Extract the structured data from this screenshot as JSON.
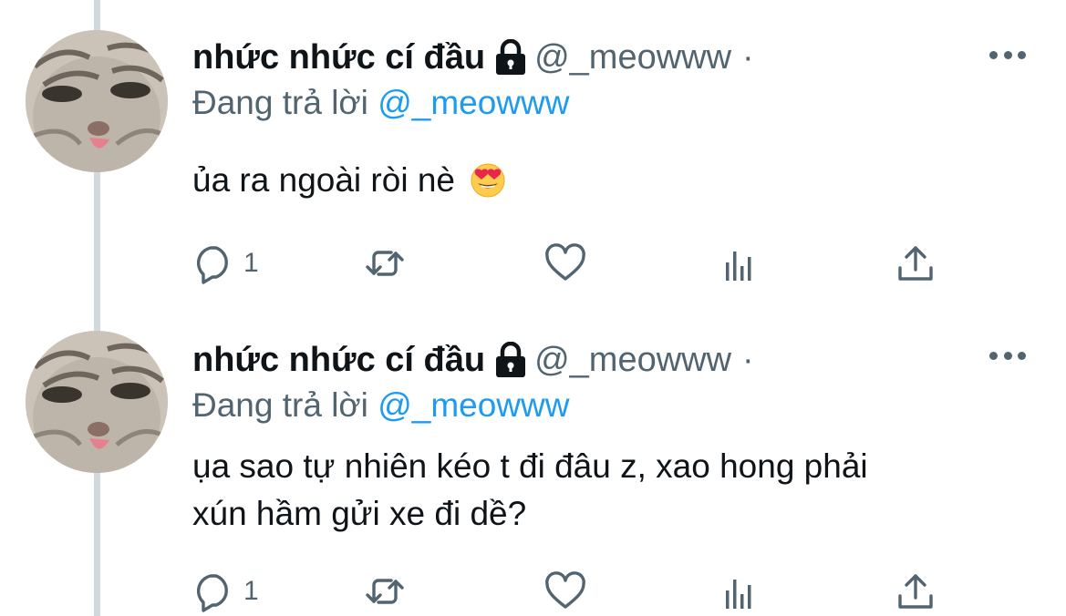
{
  "colors": {
    "accent": "#1d9bf0",
    "text": "#0f1419",
    "secondary": "#536471",
    "thread_line": "#cfd9de"
  },
  "tweets": [
    {
      "display_name": "nhức nhức cí đầu",
      "protected_icon": "lock-icon",
      "handle": "@_meowww",
      "dot": "·",
      "replying_prefix": "Đang trả lời",
      "replying_to": "@_meowww",
      "text_lines": [
        "ủa ra ngoài ròi nè"
      ],
      "emoji": "smiling-face-with-heart-eyes-emoji",
      "reply_count": "1",
      "icons": [
        "reply-icon",
        "retweet-icon",
        "like-icon",
        "views-icon",
        "share-icon"
      ]
    },
    {
      "display_name": "nhức nhức cí đầu",
      "protected_icon": "lock-icon",
      "handle": "@_meowww",
      "dot": "·",
      "replying_prefix": "Đang trả lời",
      "replying_to": "@_meowww",
      "text_lines": [
        "ụa sao tự nhiên kéo t đi đâu z, xao hong phải",
        "xún hầm gửi xe đi dề?"
      ],
      "reply_count": "1",
      "icons": [
        "reply-icon",
        "retweet-icon",
        "like-icon",
        "views-icon",
        "share-icon"
      ]
    }
  ]
}
